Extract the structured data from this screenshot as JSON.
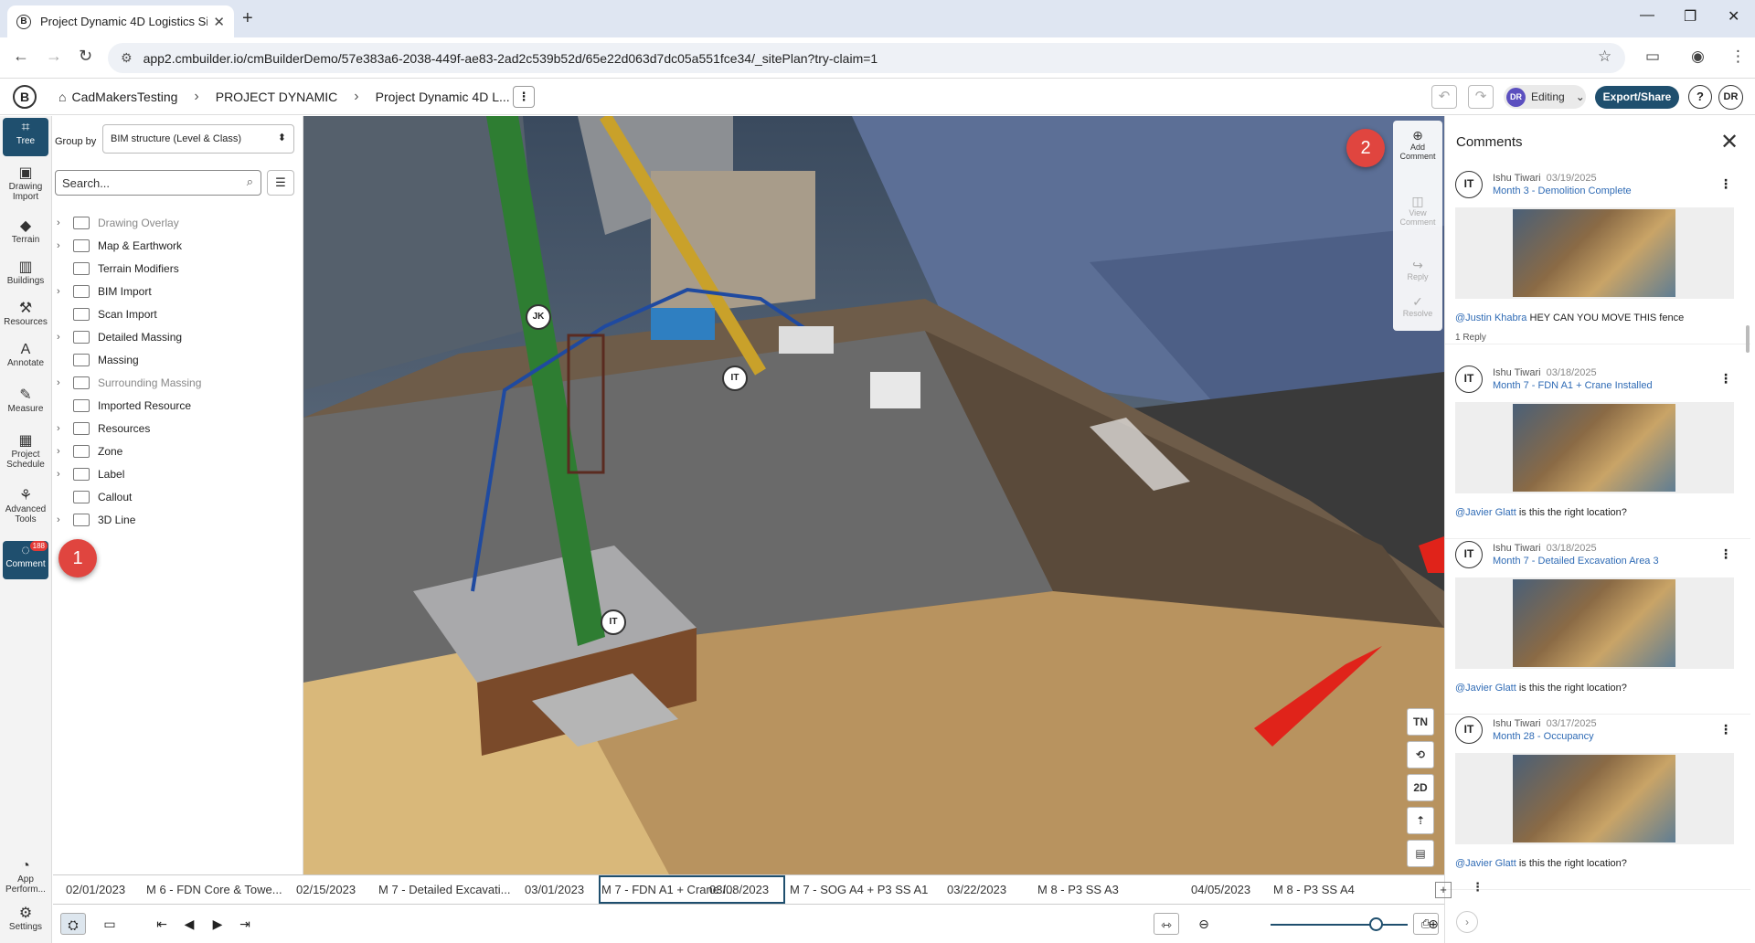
{
  "browser": {
    "tab_title": "Project Dynamic 4D Logistics Si",
    "tab_close": "✕",
    "new_tab": "+",
    "url": "app2.cmbuilder.io/cmBuilderDemo/57e383a6-2038-449f-ae83-2ad2c539b52d/65e22d063d7dc05a551fce34/_sitePlan?try-claim=1",
    "window_controls": [
      "—",
      "❐",
      "✕"
    ]
  },
  "header": {
    "logo": "B",
    "breadcrumbs": [
      "CadMakersTesting",
      "PROJECT DYNAMIC",
      "Project Dynamic 4D L..."
    ],
    "more": "⋮",
    "editing_avatar": "DR",
    "editing_label": "Editing",
    "export_label": "Export/Share",
    "help": "?",
    "user_avatar": "DR"
  },
  "rail": {
    "items": [
      {
        "label": "Tree",
        "icon": "tree-icon"
      },
      {
        "label": "Drawing Import",
        "icon": "drawing-import-icon"
      },
      {
        "label": "Terrain",
        "icon": "terrain-icon"
      },
      {
        "label": "Buildings",
        "icon": "buildings-icon"
      },
      {
        "label": "Resources",
        "icon": "resources-icon"
      },
      {
        "label": "Annotate",
        "icon": "annotate-icon"
      },
      {
        "label": "Measure",
        "icon": "measure-icon"
      },
      {
        "label": "Project Schedule",
        "icon": "schedule-icon"
      },
      {
        "label": "Advanced Tools",
        "icon": "advanced-tools-icon"
      },
      {
        "label": "Comment",
        "icon": "comment-icon",
        "badge": "188"
      }
    ],
    "bottom": [
      {
        "label": "App Perform..."
      },
      {
        "label": "Settings"
      }
    ]
  },
  "tree": {
    "group_by_label": "Group by",
    "group_by_value": "BIM structure (Level & Class)",
    "search_placeholder": "Search...",
    "items": [
      {
        "label": "Drawing Overlay",
        "dim": true
      },
      {
        "label": "Map & Earthwork",
        "dim": false
      },
      {
        "label": "Terrain Modifiers",
        "dim": false
      },
      {
        "label": "BIM Import",
        "dim": false
      },
      {
        "label": "Scan Import",
        "dim": false
      },
      {
        "label": "Detailed Massing",
        "dim": false
      },
      {
        "label": "Massing",
        "dim": false
      },
      {
        "label": "Surrounding Massing",
        "dim": true
      },
      {
        "label": "Imported Resource",
        "dim": false
      },
      {
        "label": "Resources",
        "dim": false
      },
      {
        "label": "Zone",
        "dim": false
      },
      {
        "label": "Label",
        "dim": false
      },
      {
        "label": "Callout",
        "dim": false
      },
      {
        "label": "3D Line",
        "dim": false
      }
    ]
  },
  "viewport": {
    "markers": [
      "JK",
      "IT",
      "IT"
    ],
    "annotation_1": "1",
    "annotation_2": "2",
    "tools": [
      "TN",
      "⟲",
      "2D",
      "⇡",
      "▤"
    ]
  },
  "comment_tools": [
    {
      "label": "Add Comment",
      "enabled": true
    },
    {
      "label": "View Comment",
      "enabled": false
    },
    {
      "label": "Reply",
      "enabled": false
    },
    {
      "label": "Resolve",
      "enabled": false
    }
  ],
  "comments": {
    "title": "Comments",
    "close": "✕",
    "items": [
      {
        "avatar": "IT",
        "author": "Ishu Tiwari",
        "date": "03/19/2025",
        "title": "Month 3 - Demolition Complete",
        "mention": "@Justin Khabra",
        "text": " HEY CAN YOU MOVE THIS fence",
        "reply": "1 Reply"
      },
      {
        "avatar": "IT",
        "author": "Ishu Tiwari",
        "date": "03/18/2025",
        "title": "Month 7 - FDN A1 + Crane Installed",
        "mention": "@Javier Glatt",
        "text": " is this the right location?",
        "reply": ""
      },
      {
        "avatar": "IT",
        "author": "Ishu Tiwari",
        "date": "03/18/2025",
        "title": "Month 7 - Detailed Excavation Area 3",
        "mention": "@Javier Glatt",
        "text": " is this the right location?",
        "reply": ""
      },
      {
        "avatar": "IT",
        "author": "Ishu Tiwari",
        "date": "03/17/2025",
        "title": "Month 28 - Occupancy",
        "mention": "@Javier Glatt",
        "text": " is this the right location?",
        "reply": ""
      }
    ]
  },
  "timeline": {
    "items": [
      "02/01/2023",
      "M 6 - FDN Core & Towe...",
      "02/15/2023",
      "M 7 - Detailed Excavati...",
      "03/01/2023",
      "M 7 - FDN A1 + Crane I...",
      "03/08/2023",
      "M 7 - SOG A4 + P3 SS A1",
      "03/22/2023",
      "M 8 - P3 SS A3",
      "04/05/2023",
      "M 8 - P3 SS A4"
    ],
    "selected": "M 7 - FDN A1 + Crane I...   03/08/2023"
  },
  "player": {
    "buttons": [
      "⇤",
      "◀",
      "▶",
      "⇥"
    ]
  }
}
